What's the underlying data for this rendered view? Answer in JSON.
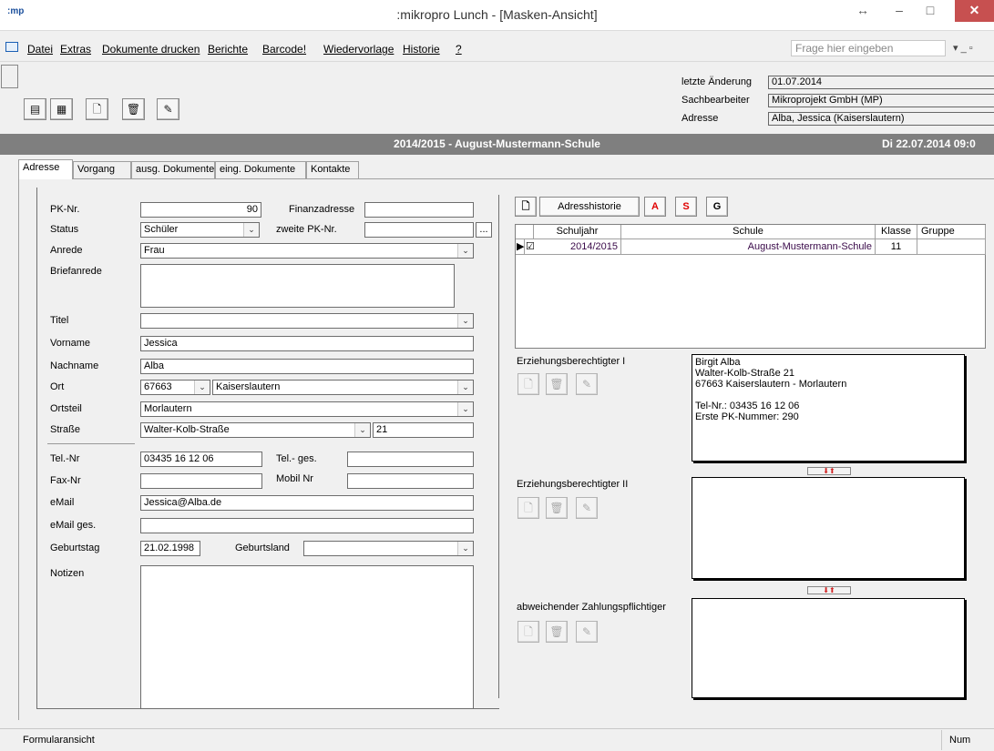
{
  "window": {
    "app_icon": ":mp",
    "title": ":mikropro Lunch - [Masken-Ansicht]",
    "resize_glyph": "↔",
    "min_glyph": "–",
    "max_glyph": "□",
    "close_glyph": "✕"
  },
  "menu": {
    "items": [
      "Datei",
      "Extras",
      "Dokumente drucken",
      "Berichte",
      "Barcode!",
      "Wiedervorlage",
      "Historie",
      "?"
    ],
    "help_placeholder": "Frage hier eingeben",
    "mdi_controls": "▾  _  ▫"
  },
  "toolbar": {
    "form_view_label": "▤",
    "table_view_label": "▦",
    "new_label": "🗋",
    "delete_label": "🗑",
    "edit_label": "✎"
  },
  "info": {
    "last_change_label": "letzte Änderung",
    "last_change_value": "01.07.2014",
    "clerk_label": "Sachbearbeiter",
    "clerk_value": "Mikroprojekt GmbH (MP)",
    "address_label": "Adresse",
    "address_value": "Alba, Jessica (Kaiserslautern)"
  },
  "header": {
    "title": "2014/2015 - August-Mustermann-Schule",
    "date": "Di 22.07.2014 09:0"
  },
  "tabs": [
    "Adresse",
    "Vorgang",
    "ausg. Dokumente",
    "eing. Dokumente",
    "Kontakte"
  ],
  "form": {
    "pk_label": "PK-Nr.",
    "pk_value": "90",
    "finance_label": "Finanzadresse",
    "finance_value": "",
    "status_label": "Status",
    "status_value": "Schüler",
    "second_pk_label": "zweite PK-Nr.",
    "second_pk_value": "",
    "second_pk_button": "...",
    "salutation_label": "Anrede",
    "salutation_value": "Frau",
    "letter_salutation_label": "Briefanrede",
    "letter_salutation_value": "",
    "title_label": "Titel",
    "title_value": "",
    "firstname_label": "Vorname",
    "firstname_value": "Jessica",
    "lastname_label": "Nachname",
    "lastname_value": "Alba",
    "city_label": "Ort",
    "zip_value": "67663",
    "city_value": "Kaiserslautern",
    "district_label": "Ortsteil",
    "district_value": "Morlautern",
    "street_label": "Straße",
    "street_value": "Walter-Kolb-Straße",
    "house_no_value": "21",
    "phone_label": "Tel.-Nr",
    "phone_value": "03435 16 12 06",
    "phone_biz_label": "Tel.- ges.",
    "phone_biz_value": "",
    "fax_label": "Fax-Nr",
    "fax_value": "",
    "mobile_label": "Mobil Nr",
    "mobile_value": "",
    "email_label": "eMail",
    "email_value": "Jessica@Alba.de",
    "email_biz_label": "eMail ges.",
    "email_biz_value": "",
    "birthday_label": "Geburtstag",
    "birthday_value": "21.02.1998",
    "birth_country_label": "Geburtsland",
    "birth_country_value": "",
    "notes_label": "Notizen",
    "notes_value": ""
  },
  "right": {
    "new_button": "🗋",
    "history_button": "Adresshistorie",
    "a_button": "A",
    "s_button": "S",
    "g_button": "G",
    "grid_headers": [
      "Schuljahr",
      "Schule",
      "Klasse",
      "Gruppe"
    ],
    "grid_rows": [
      {
        "selector": "▶",
        "check": "☑",
        "year": "2014/2015",
        "school": "August-Mustermann-Schule",
        "class": "11",
        "group": ""
      }
    ],
    "guardian1_label": "Erziehungsberechtigter I",
    "guardian1_lines": [
      "Birgit Alba",
      "Walter-Kolb-Straße 21",
      "67663 Kaiserslautern - Morlautern",
      "",
      "Tel-Nr.: 03435 16 12 06",
      "Erste PK-Nummer: 290"
    ],
    "guardian2_label": "Erziehungsberechtigter II",
    "payer_label": "abweichender Zahlungspflichtiger",
    "move_arrows": "⬇⬆",
    "small_new": "🗋",
    "small_delete": "🗑",
    "small_edit": "✎"
  },
  "status": {
    "left": "Formularansicht",
    "num": "Num"
  }
}
